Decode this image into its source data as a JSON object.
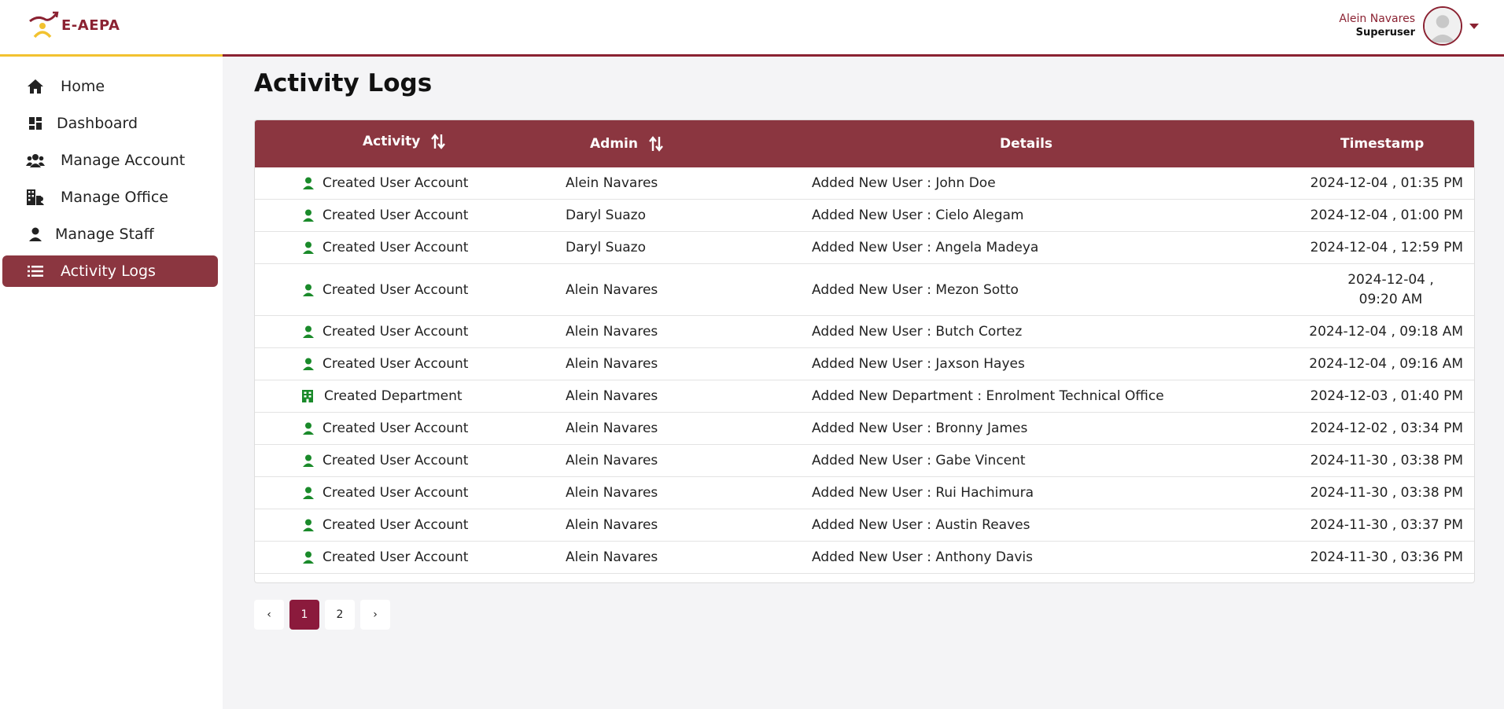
{
  "app": {
    "logo_text": "E-AEPA"
  },
  "user": {
    "name": "Alein Navares",
    "role": "Superuser"
  },
  "sidebar": {
    "items": [
      {
        "label": "Home",
        "icon": "home-icon"
      },
      {
        "label": "Dashboard",
        "icon": "dashboard-icon"
      },
      {
        "label": "Manage Account",
        "icon": "users-icon"
      },
      {
        "label": "Manage Office",
        "icon": "office-icon"
      },
      {
        "label": "Manage Staff",
        "icon": "staff-icon"
      },
      {
        "label": "Activity Logs",
        "icon": "list-icon",
        "active": true
      }
    ]
  },
  "main": {
    "title": "Activity Logs",
    "table": {
      "headers": {
        "activity": "Activity",
        "admin": "Admin",
        "details": "Details",
        "timestamp": "Timestamp"
      },
      "rows": [
        {
          "activity": "Created User Account",
          "icon": "user-icon",
          "admin": "Alein Navares",
          "details": "Added New User : John Doe",
          "timestamp": "2024-12-04 , 01:35 PM"
        },
        {
          "activity": "Created User Account",
          "icon": "user-icon",
          "admin": "Daryl Suazo",
          "details": "Added New User : Cielo Alegam",
          "timestamp": "2024-12-04 , 01:00 PM"
        },
        {
          "activity": "Created User Account",
          "icon": "user-icon",
          "admin": "Daryl Suazo",
          "details": "Added New User : Angela Madeya",
          "timestamp": "2024-12-04 , 12:59 PM"
        },
        {
          "activity": "Created User Account",
          "icon": "user-icon",
          "admin": "Alein Navares",
          "details": "Added New User : Mezon Sotto",
          "timestamp": "2024-12-04 , 09:20 AM"
        },
        {
          "activity": "Created User Account",
          "icon": "user-icon",
          "admin": "Alein Navares",
          "details": "Added New User : Butch Cortez",
          "timestamp": "2024-12-04 , 09:18 AM"
        },
        {
          "activity": "Created User Account",
          "icon": "user-icon",
          "admin": "Alein Navares",
          "details": "Added New User : Jaxson Hayes",
          "timestamp": "2024-12-04 , 09:16 AM"
        },
        {
          "activity": "Created Department",
          "icon": "building-icon",
          "admin": "Alein Navares",
          "details": "Added New Department : Enrolment Technical Office",
          "timestamp": "2024-12-03 , 01:40 PM"
        },
        {
          "activity": "Created User Account",
          "icon": "user-icon",
          "admin": "Alein Navares",
          "details": "Added New User : Bronny James",
          "timestamp": "2024-12-02 , 03:34 PM"
        },
        {
          "activity": "Created User Account",
          "icon": "user-icon",
          "admin": "Alein Navares",
          "details": "Added New User : Gabe Vincent",
          "timestamp": "2024-11-30 , 03:38 PM"
        },
        {
          "activity": "Created User Account",
          "icon": "user-icon",
          "admin": "Alein Navares",
          "details": "Added New User : Rui Hachimura",
          "timestamp": "2024-11-30 , 03:38 PM"
        },
        {
          "activity": "Created User Account",
          "icon": "user-icon",
          "admin": "Alein Navares",
          "details": "Added New User : Austin Reaves",
          "timestamp": "2024-11-30 , 03:37 PM"
        },
        {
          "activity": "Created User Account",
          "icon": "user-icon",
          "admin": "Alein Navares",
          "details": "Added New User : Anthony Davis",
          "timestamp": "2024-11-30 , 03:36 PM"
        }
      ]
    },
    "pagination": {
      "prev": "‹",
      "pages": [
        "1",
        "2"
      ],
      "current": "1",
      "next": "›"
    }
  },
  "colors": {
    "brand": "#8b2232",
    "header_bg": "#8b3640",
    "gold": "#f2c230",
    "icon_green": "#1a8a2a",
    "page_active": "#8b1a3c"
  }
}
